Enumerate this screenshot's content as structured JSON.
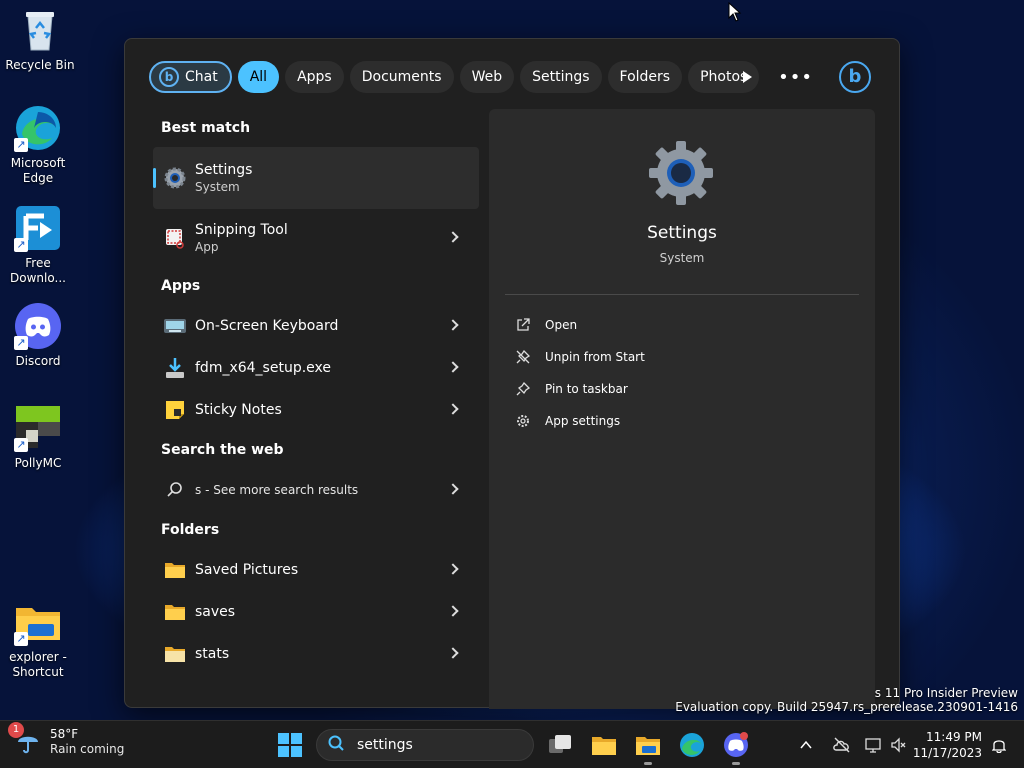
{
  "desktop": {
    "icons": [
      {
        "label": "Recycle Bin"
      },
      {
        "label": "Microsoft Edge"
      },
      {
        "label": "Free Downlo..."
      },
      {
        "label": "Discord"
      },
      {
        "label": "PollyMC"
      },
      {
        "label": "explorer - Shortcut"
      }
    ],
    "watermark": {
      "line1": "s 11 Pro Insider Preview",
      "line2": "Evaluation copy. Build 25947.rs_prerelease.230901-1416"
    }
  },
  "search_panel": {
    "filters": [
      {
        "label": "Chat"
      },
      {
        "label": "All"
      },
      {
        "label": "Apps"
      },
      {
        "label": "Documents"
      },
      {
        "label": "Web"
      },
      {
        "label": "Settings"
      },
      {
        "label": "Folders"
      },
      {
        "label": "Photos"
      }
    ],
    "active_filter": "All",
    "sections": {
      "best_match": "Best match",
      "apps": "Apps",
      "web": "Search the web",
      "folders": "Folders"
    },
    "results": {
      "settings": {
        "title": "Settings",
        "sub": "System"
      },
      "snipping": {
        "title": "Snipping Tool",
        "sub": "App"
      },
      "osk": {
        "title": "On-Screen Keyboard"
      },
      "fdm": {
        "title": "fdm_x64_setup.exe"
      },
      "sticky": {
        "title": "Sticky Notes"
      },
      "web": {
        "title": "s - See more search results"
      },
      "saved_pictures": {
        "title": "Saved Pictures"
      },
      "saves": {
        "title": "saves"
      },
      "stats": {
        "title": "stats"
      }
    },
    "detail": {
      "title": "Settings",
      "sub": "System",
      "actions": [
        {
          "label": "Open"
        },
        {
          "label": "Unpin from Start"
        },
        {
          "label": "Pin to taskbar"
        },
        {
          "label": "App settings"
        }
      ]
    }
  },
  "taskbar": {
    "weather": {
      "temp": "58°F",
      "cond": "Rain coming",
      "badge": "1"
    },
    "search_value": "settings",
    "clock": {
      "time": "11:49 PM",
      "date": "11/17/2023"
    }
  },
  "colors": {
    "accent": "#4cc2ff",
    "panel_bg": "#202020",
    "detail_bg": "#2b2b2b",
    "taskbar_bg": "#1c1c1c"
  }
}
